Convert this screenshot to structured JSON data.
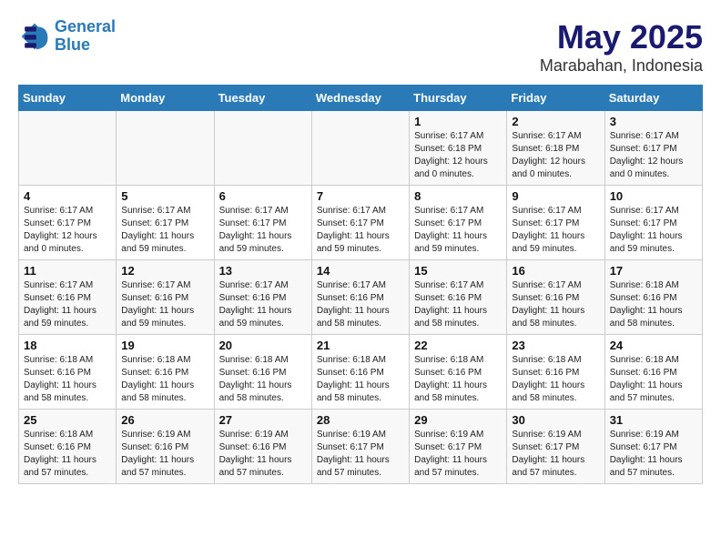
{
  "logo": {
    "line1": "General",
    "line2": "Blue"
  },
  "title": "May 2025",
  "subtitle": "Marabahan, Indonesia",
  "days_of_week": [
    "Sunday",
    "Monday",
    "Tuesday",
    "Wednesday",
    "Thursday",
    "Friday",
    "Saturday"
  ],
  "weeks": [
    [
      {
        "day": "",
        "info": ""
      },
      {
        "day": "",
        "info": ""
      },
      {
        "day": "",
        "info": ""
      },
      {
        "day": "",
        "info": ""
      },
      {
        "day": "1",
        "info": "Sunrise: 6:17 AM\nSunset: 6:18 PM\nDaylight: 12 hours\nand 0 minutes."
      },
      {
        "day": "2",
        "info": "Sunrise: 6:17 AM\nSunset: 6:18 PM\nDaylight: 12 hours\nand 0 minutes."
      },
      {
        "day": "3",
        "info": "Sunrise: 6:17 AM\nSunset: 6:17 PM\nDaylight: 12 hours\nand 0 minutes."
      }
    ],
    [
      {
        "day": "4",
        "info": "Sunrise: 6:17 AM\nSunset: 6:17 PM\nDaylight: 12 hours\nand 0 minutes."
      },
      {
        "day": "5",
        "info": "Sunrise: 6:17 AM\nSunset: 6:17 PM\nDaylight: 11 hours\nand 59 minutes."
      },
      {
        "day": "6",
        "info": "Sunrise: 6:17 AM\nSunset: 6:17 PM\nDaylight: 11 hours\nand 59 minutes."
      },
      {
        "day": "7",
        "info": "Sunrise: 6:17 AM\nSunset: 6:17 PM\nDaylight: 11 hours\nand 59 minutes."
      },
      {
        "day": "8",
        "info": "Sunrise: 6:17 AM\nSunset: 6:17 PM\nDaylight: 11 hours\nand 59 minutes."
      },
      {
        "day": "9",
        "info": "Sunrise: 6:17 AM\nSunset: 6:17 PM\nDaylight: 11 hours\nand 59 minutes."
      },
      {
        "day": "10",
        "info": "Sunrise: 6:17 AM\nSunset: 6:17 PM\nDaylight: 11 hours\nand 59 minutes."
      }
    ],
    [
      {
        "day": "11",
        "info": "Sunrise: 6:17 AM\nSunset: 6:16 PM\nDaylight: 11 hours\nand 59 minutes."
      },
      {
        "day": "12",
        "info": "Sunrise: 6:17 AM\nSunset: 6:16 PM\nDaylight: 11 hours\nand 59 minutes."
      },
      {
        "day": "13",
        "info": "Sunrise: 6:17 AM\nSunset: 6:16 PM\nDaylight: 11 hours\nand 59 minutes."
      },
      {
        "day": "14",
        "info": "Sunrise: 6:17 AM\nSunset: 6:16 PM\nDaylight: 11 hours\nand 58 minutes."
      },
      {
        "day": "15",
        "info": "Sunrise: 6:17 AM\nSunset: 6:16 PM\nDaylight: 11 hours\nand 58 minutes."
      },
      {
        "day": "16",
        "info": "Sunrise: 6:17 AM\nSunset: 6:16 PM\nDaylight: 11 hours\nand 58 minutes."
      },
      {
        "day": "17",
        "info": "Sunrise: 6:18 AM\nSunset: 6:16 PM\nDaylight: 11 hours\nand 58 minutes."
      }
    ],
    [
      {
        "day": "18",
        "info": "Sunrise: 6:18 AM\nSunset: 6:16 PM\nDaylight: 11 hours\nand 58 minutes."
      },
      {
        "day": "19",
        "info": "Sunrise: 6:18 AM\nSunset: 6:16 PM\nDaylight: 11 hours\nand 58 minutes."
      },
      {
        "day": "20",
        "info": "Sunrise: 6:18 AM\nSunset: 6:16 PM\nDaylight: 11 hours\nand 58 minutes."
      },
      {
        "day": "21",
        "info": "Sunrise: 6:18 AM\nSunset: 6:16 PM\nDaylight: 11 hours\nand 58 minutes."
      },
      {
        "day": "22",
        "info": "Sunrise: 6:18 AM\nSunset: 6:16 PM\nDaylight: 11 hours\nand 58 minutes."
      },
      {
        "day": "23",
        "info": "Sunrise: 6:18 AM\nSunset: 6:16 PM\nDaylight: 11 hours\nand 58 minutes."
      },
      {
        "day": "24",
        "info": "Sunrise: 6:18 AM\nSunset: 6:16 PM\nDaylight: 11 hours\nand 57 minutes."
      }
    ],
    [
      {
        "day": "25",
        "info": "Sunrise: 6:18 AM\nSunset: 6:16 PM\nDaylight: 11 hours\nand 57 minutes."
      },
      {
        "day": "26",
        "info": "Sunrise: 6:19 AM\nSunset: 6:16 PM\nDaylight: 11 hours\nand 57 minutes."
      },
      {
        "day": "27",
        "info": "Sunrise: 6:19 AM\nSunset: 6:16 PM\nDaylight: 11 hours\nand 57 minutes."
      },
      {
        "day": "28",
        "info": "Sunrise: 6:19 AM\nSunset: 6:17 PM\nDaylight: 11 hours\nand 57 minutes."
      },
      {
        "day": "29",
        "info": "Sunrise: 6:19 AM\nSunset: 6:17 PM\nDaylight: 11 hours\nand 57 minutes."
      },
      {
        "day": "30",
        "info": "Sunrise: 6:19 AM\nSunset: 6:17 PM\nDaylight: 11 hours\nand 57 minutes."
      },
      {
        "day": "31",
        "info": "Sunrise: 6:19 AM\nSunset: 6:17 PM\nDaylight: 11 hours\nand 57 minutes."
      }
    ]
  ]
}
